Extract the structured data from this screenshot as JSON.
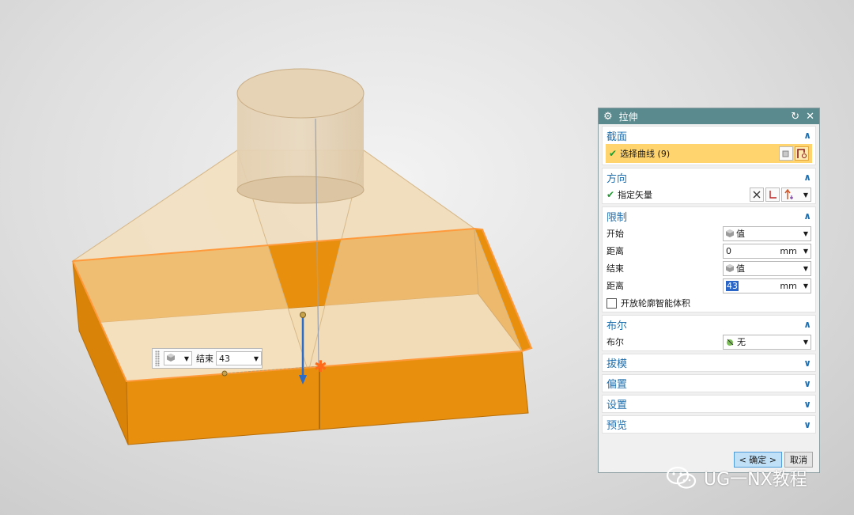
{
  "float_input": {
    "type_icon": "cube-icon",
    "label": "结束",
    "value": "43"
  },
  "dialog": {
    "title": "拉伸",
    "sections": {
      "section": {
        "title": "截面",
        "select_curve": "选择曲线 (9)"
      },
      "direction": {
        "title": "方向",
        "specify_vector": "指定矢量"
      },
      "limits": {
        "title": "限制",
        "start_label": "开始",
        "start_mode": "值",
        "start_distance_label": "距离",
        "start_distance": "0",
        "end_label": "结束",
        "end_mode": "值",
        "end_distance_label": "距离",
        "end_distance": "43",
        "unit": "mm",
        "open_profile_label": "开放轮廓智能体积"
      },
      "boolean": {
        "title": "布尔",
        "label": "布尔",
        "value": "无"
      },
      "draft": {
        "title": "拔模"
      },
      "offset": {
        "title": "偏置"
      },
      "settings": {
        "title": "设置"
      },
      "preview": {
        "title": "预览"
      }
    },
    "ok_label": "< 确定 >",
    "cancel_label": "取消"
  },
  "watermark": "UG一NX教程",
  "colors": {
    "solid": "#e8900e",
    "title_bar": "#5b8a8e",
    "highlight": "#ffd46e",
    "section_heading": "#1f6fae"
  }
}
